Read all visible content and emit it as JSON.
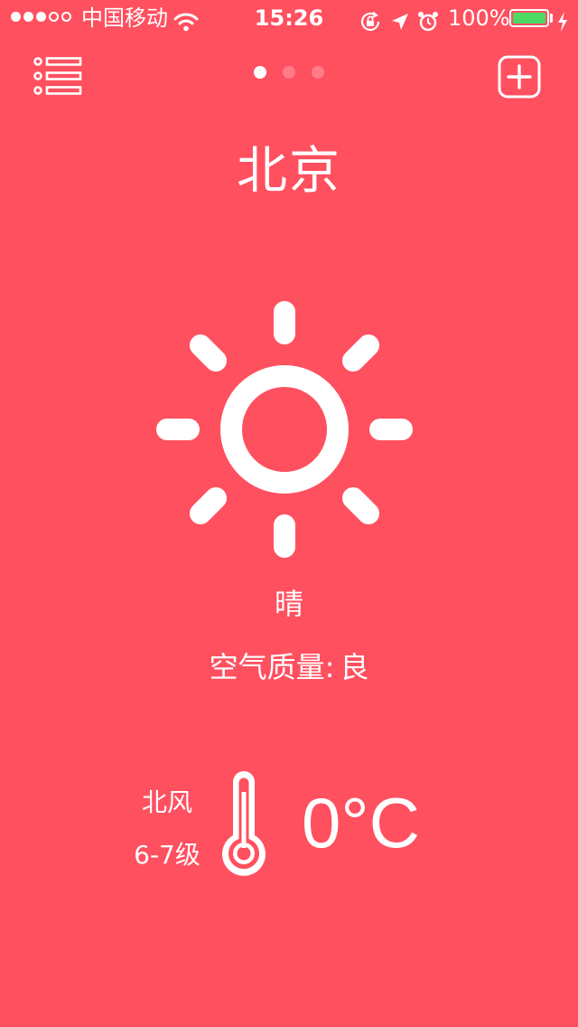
{
  "status_bar": {
    "signal_strength": "3/5",
    "carrier": "中国移动",
    "time": "15:26",
    "battery_percent": "100%",
    "battery_level": 1.0,
    "icons": [
      "wifi-icon",
      "orientation-lock-icon",
      "location-arrow-icon",
      "alarm-icon",
      "battery-icon",
      "charging-bolt-icon"
    ]
  },
  "nav": {
    "menu_icon": "list-menu-icon",
    "add_icon": "add-city-icon",
    "pages": {
      "total": 3,
      "active": 1
    }
  },
  "weather": {
    "city": "北京",
    "icon": "sun-icon",
    "condition": "晴",
    "air_quality_label": "空气质量:",
    "air_quality_value": "良",
    "wind_direction": "北风",
    "wind_level": "6-7级",
    "thermometer_icon": "thermometer-icon",
    "temperature": "0°C"
  },
  "colors": {
    "background": "#ff5060",
    "foreground": "#ffffff",
    "battery_fill": "#4cd964"
  }
}
